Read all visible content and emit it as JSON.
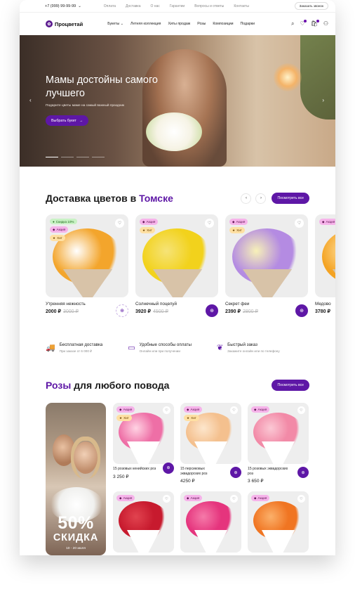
{
  "topbar": {
    "phone": "+7 (999) 99-99-99",
    "links": [
      "Оплата",
      "Доставка",
      "О нас",
      "Гарантии",
      "Вопросы и ответы",
      "Контакты"
    ],
    "call_label": "Заказать звонок"
  },
  "nav": {
    "logo": "Процветай",
    "items": [
      "Букеты",
      "Летняя коллекция",
      "Хиты продаж",
      "Розы",
      "Композиции",
      "Подарки"
    ]
  },
  "hero": {
    "title": "Мамы достойны самого лучшего",
    "subtitle": "Подарите цветы маме на самый важный праздник",
    "button": "Выбрать букет",
    "slides": 4,
    "active_slide": 1
  },
  "delivery": {
    "title_main": "Доставка цветов в ",
    "title_accent": "Томске",
    "button": "Посмотреть все",
    "products": [
      {
        "name": "Утренняя нежность",
        "price": "2000 ₽",
        "old": "3000 ₽",
        "badges": [
          "Скидка 10%",
          "Акция",
          "Хит"
        ],
        "colors": [
          "#f3a52c",
          "#ffffff"
        ]
      },
      {
        "name": "Солнечный поцелуй",
        "price": "3920 ₽",
        "old": "4500 ₽",
        "badges": [
          "Акция",
          "Хит"
        ],
        "colors": [
          "#f2d21c",
          "#f6e377"
        ]
      },
      {
        "name": "Секрет феи",
        "price": "2390 ₽",
        "old": "2800 ₽",
        "badges": [
          "Акция",
          "Хит"
        ],
        "colors": [
          "#b48be2",
          "#f7f1b8"
        ]
      },
      {
        "name": "Медово",
        "price": "3780 ₽",
        "old": "",
        "badges": [
          "Акция"
        ],
        "colors": [
          "#f4a323",
          "#ffe4a8"
        ]
      }
    ]
  },
  "features": [
    {
      "title": "Бесплатная доставка",
      "desc": "При заказе от 6 000 ₽",
      "icon": "truck-icon"
    },
    {
      "title": "Удобные способы оплаты",
      "desc": "Онлайн или при получении",
      "icon": "card-icon"
    },
    {
      "title": "Быстрый заказ",
      "desc": "Закажите онлайн или по телефону",
      "icon": "balloon-icon"
    }
  ],
  "roses": {
    "title_accent": "Розы",
    "title_main": " для любого повода",
    "button": "Посмотреть все",
    "promo": {
      "big": "50%",
      "label": "СКИДКА",
      "dates": "10 - 20 июля"
    },
    "products": [
      {
        "name": "15 розовых кенийских роз",
        "price": "3 250 ₽",
        "badges": [
          "Акция",
          "Хит"
        ],
        "colors": [
          "#ee6fa6",
          "#ffd3e3"
        ]
      },
      {
        "name": "15 персиковых эквадорских роз",
        "price": "4250 ₽",
        "badges": [
          "Акция",
          "Хит"
        ],
        "colors": [
          "#f4c08e",
          "#fde6cc"
        ]
      },
      {
        "name": "15 розовых эквадорских роз",
        "price": "3 650 ₽",
        "badges": [
          "Акция"
        ],
        "colors": [
          "#f28aa7",
          "#fbc8d4"
        ]
      },
      {
        "name": "",
        "price": "",
        "badges": [
          "Акция"
        ],
        "colors": [
          "#c71a2e",
          "#e1434f"
        ]
      },
      {
        "name": "",
        "price": "",
        "badges": [
          "Акция"
        ],
        "colors": [
          "#e5347d",
          "#f57aa9"
        ]
      },
      {
        "name": "",
        "price": "",
        "badges": [
          "Акция"
        ],
        "colors": [
          "#f07522",
          "#fbb06a"
        ]
      }
    ]
  }
}
